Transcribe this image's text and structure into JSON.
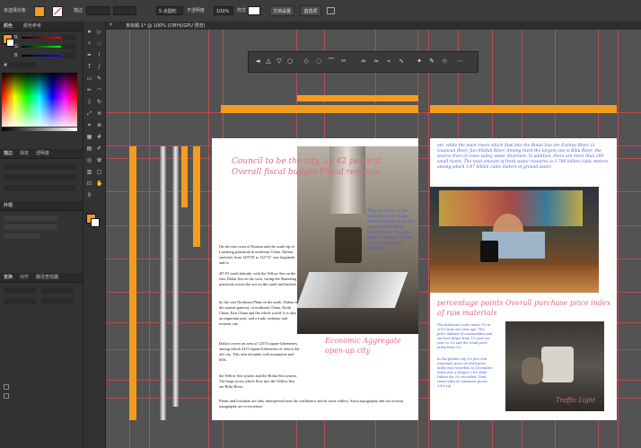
{
  "control_bar": {
    "doc_label": "未选择对象",
    "stroke_label": "描边",
    "brush_label": "5 点圆形",
    "opacity_label": "不透明度",
    "opacity_value": "100%",
    "style_label": "样式",
    "doc_settings_button": "文档设置",
    "prefs_button": "首选项"
  },
  "left_panel": {
    "color_tabs": [
      "颜色",
      "颜色参考"
    ],
    "swatch_tabs": [
      "描边",
      "渐变",
      "透明度"
    ],
    "appearance_label": "外观",
    "layers_tabs": [
      "变换",
      "对齐",
      "路径查找器"
    ],
    "channels": [
      "R",
      "G",
      "B"
    ],
    "hex_prefix": "#"
  },
  "document_tab": {
    "title": "未标题-1* @ 100% (CMYK/GPU 预览)",
    "close_glyph": "×"
  },
  "icons": {
    "tools": [
      "selection-icon",
      "direct-selection-icon",
      "magic-wand-icon",
      "lasso-icon",
      "pen-icon",
      "curvature-icon",
      "type-icon",
      "line-icon",
      "rectangle-icon",
      "paintbrush-icon",
      "pencil-icon",
      "shaper-icon",
      "eraser-icon",
      "rotate-icon",
      "scale-icon",
      "width-icon",
      "free-transform-icon",
      "shape-builder-icon",
      "perspective-icon",
      "mesh-icon",
      "gradient-icon",
      "eyedropper-icon",
      "blend-icon",
      "symbol-sprayer-icon",
      "graph-icon",
      "artboard-icon",
      "slice-icon",
      "hand-icon",
      "zoom-icon"
    ]
  },
  "page_left": {
    "heading": "Council to be the city, up 42 percent. Overall fiscal budget Fiscal revenue",
    "subheading": "Economic Aggregate open-up city",
    "blue_notes": "This sentence is the sentence Kayu-Suer county Dalian area 360 square kilometers introduction The land area of Dalian of 2015 and the chemical industry",
    "paragraphs": [
      "On the east coast of Eurasia and the south tip of Liaodong peninsula in northeast China. Dalian stretches from 120°58' to 123°31' east longitude and to",
      "40°10' north latitude, with the Yellow Sea on the east, Bohai Sea on the west, facing the Shandong peninsula across the sea on the south and backed",
      "by the vast Northeast Plain on the north. Dalian is the marine gateway of northeast China, North China, East China and the whole world. It is also an important port, and a trade, industry and tourism city.",
      "Dalian covers an area of 12574 square kilometers, among which 2415 square kilometers of area is the old city. This area abounds with mountains and hills.",
      "the Yellow Sea system and the Bohai Sea system. The large rivers which flow into the Yellow Sea are Biliu River,",
      "Plains and lowlands are only interspersed near the confluence and in some valleys. Karst topography and sea erosion topography are everywhere."
    ]
  },
  "page_right": {
    "top_notes": "etc. while the main rivers which flow into the Bohai Sea are Fuzhou River, Li Guancun River, Jun Shidun River. Among them the largest one is Biliu River, the source river of cross-valley water diversion. In addition, there are more than 200 small rivers. The total amount of fresh water resource is 3.786 billion cubic meters, among which 3.47 billion cubic meters of ground water.",
    "heading": "percentage points Overall purchase price index of raw materials",
    "col_notes": "The industrial scale raises 1% in 2015 from one year ago. The price indexes of commodities and services drops from 1% year-on-year to 2% and the retail price index from 3%.",
    "col_notes_2": "In the golden city 3% per cent consumer price of retail price index was recorded. In December there was a deeper 0.4% slide. Dalian the 5% recorded. Total retail sales of consumer goods 3.4% up.",
    "caption": "Traffic Light"
  }
}
